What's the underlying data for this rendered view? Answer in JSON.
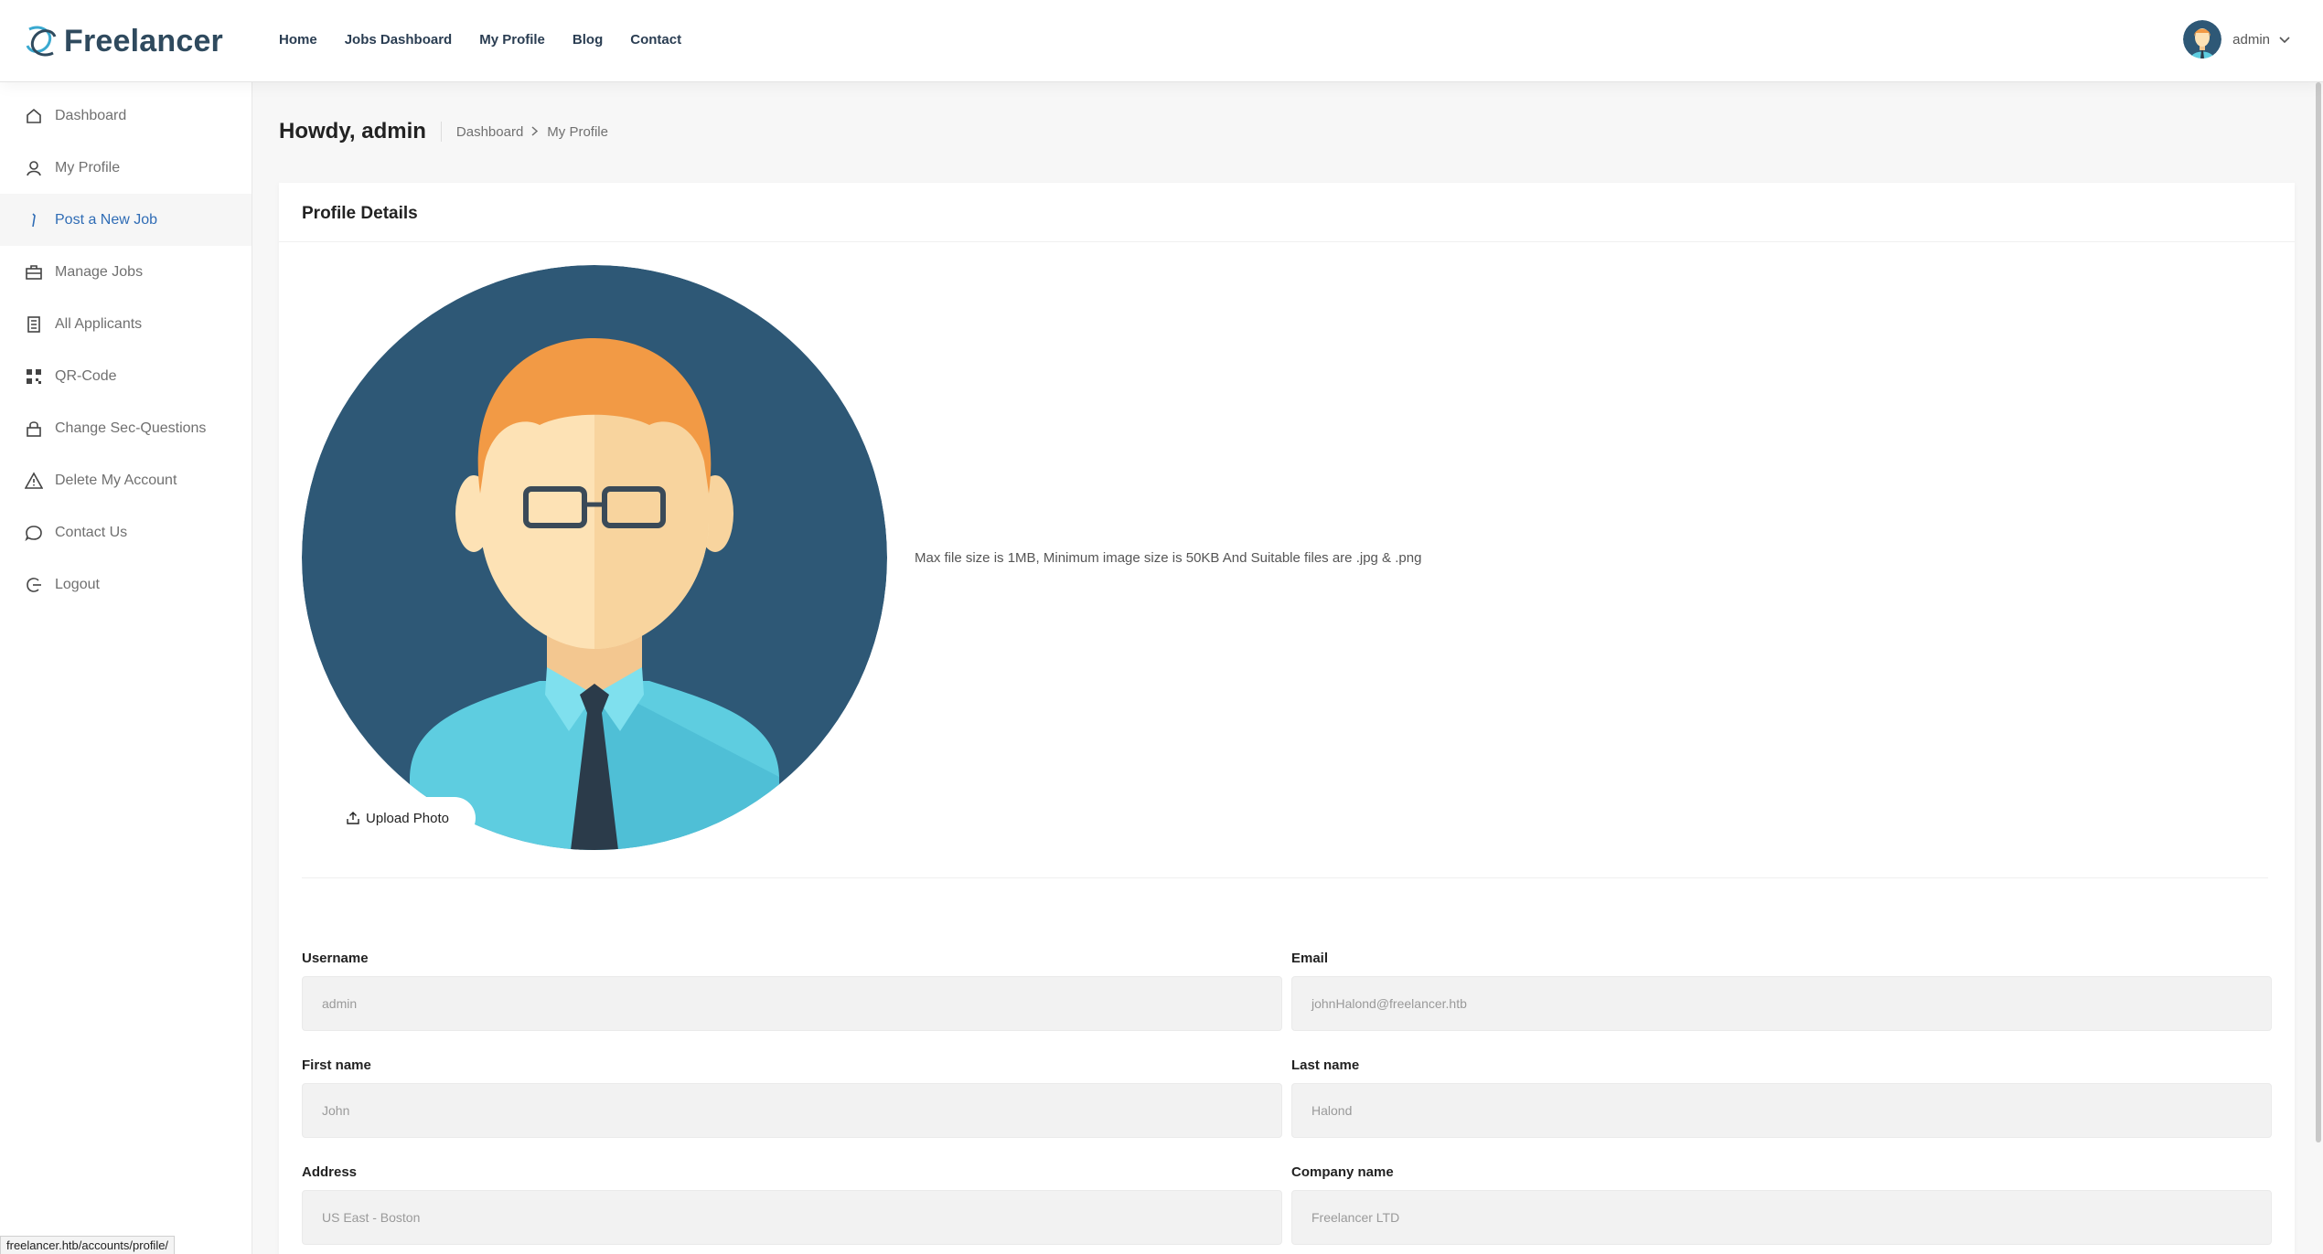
{
  "header": {
    "brand": "Freelancer",
    "nav": [
      "Home",
      "Jobs Dashboard",
      "My Profile",
      "Blog",
      "Contact"
    ],
    "user": "admin"
  },
  "sidebar": {
    "items": [
      {
        "label": "Dashboard",
        "icon": "home-icon"
      },
      {
        "label": "My Profile",
        "icon": "user-icon"
      },
      {
        "label": "Post a New Job",
        "icon": "pen-icon"
      },
      {
        "label": "Manage Jobs",
        "icon": "briefcase-icon"
      },
      {
        "label": "All Applicants",
        "icon": "list-icon"
      },
      {
        "label": "QR-Code",
        "icon": "qr-icon"
      },
      {
        "label": "Change Sec-Questions",
        "icon": "lock-icon"
      },
      {
        "label": "Delete My Account",
        "icon": "warning-icon"
      },
      {
        "label": "Contact Us",
        "icon": "chat-icon"
      },
      {
        "label": "Logout",
        "icon": "logout-icon"
      }
    ]
  },
  "page": {
    "greeting": "Howdy, admin",
    "breadcrumb": [
      "Dashboard",
      "My Profile"
    ]
  },
  "profile": {
    "title": "Profile Details",
    "upload_label": "Upload Photo",
    "file_note": "Max file size is 1MB, Minimum image size is 50KB And Suitable files are .jpg & .png",
    "fields": [
      {
        "label": "Username",
        "value": "admin"
      },
      {
        "label": "Email",
        "value": "johnHalond@freelancer.htb"
      },
      {
        "label": "First name",
        "value": "John"
      },
      {
        "label": "Last name",
        "value": "Halond"
      },
      {
        "label": "Address",
        "value": "US East - Boston"
      },
      {
        "label": "Company name",
        "value": "Freelancer LTD"
      }
    ]
  },
  "status_bar": "freelancer.htb/accounts/profile/",
  "colors": {
    "accent": "#2f6cb5",
    "brand": "#2f4a5e",
    "avatar_bg": "#2e5876"
  }
}
